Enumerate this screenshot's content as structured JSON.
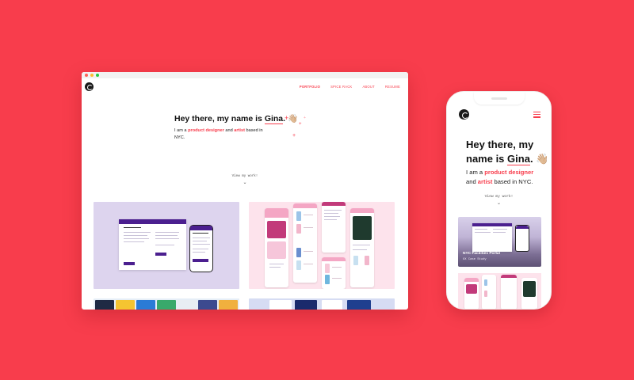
{
  "desktop": {
    "nav": {
      "items": [
        {
          "label": "PORTFOLIO",
          "active": true
        },
        {
          "label": "SPICE RACK",
          "active": false
        },
        {
          "label": "ABOUT",
          "active": false
        },
        {
          "label": "RESUME",
          "active": false
        }
      ]
    },
    "hero": {
      "greeting": "Hey there, my name is ",
      "name": "Gina",
      "punct": ".",
      "emoji": "👋🏼",
      "intro": "I am a ",
      "role1": "product designer",
      "and": " and ",
      "role2": "artist",
      "location": " based in NYC."
    },
    "scroll_prompt": "View my work!"
  },
  "mobile": {
    "hero": {
      "greeting": "Hey there, my name is ",
      "name": "Gina",
      "punct": ".",
      "emoji": "👋🏼",
      "intro": "I am a ",
      "role1": "product designer",
      "and": " and ",
      "role2": "artist",
      "location": " based in NYC."
    },
    "scroll_prompt": "View my work!",
    "card1": {
      "title": "NYC Facilities Portal",
      "subtitle": "UX Case Study"
    }
  },
  "colors": {
    "background": "#f83d4c",
    "accent": "#f83d4c",
    "brand_purple": "#4b1f8f"
  },
  "icons": {
    "logo": "logo-icon",
    "menu": "hamburger-menu-icon",
    "scroll": "chevron-down-icon",
    "decor": "cross-sparkle-icon"
  }
}
